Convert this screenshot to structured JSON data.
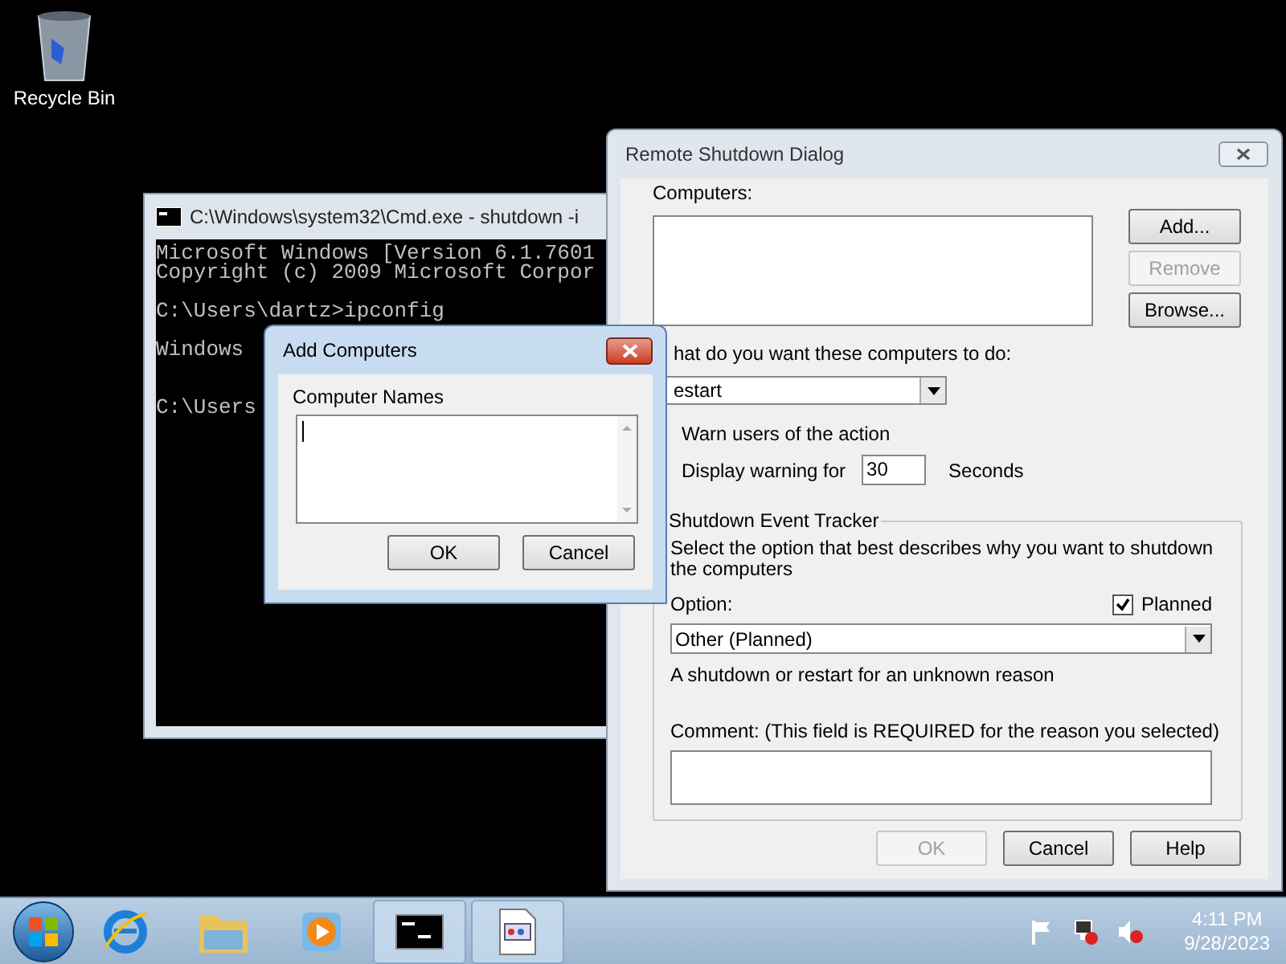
{
  "desktop_icons": [
    {
      "label": "Recycle Bin"
    }
  ],
  "cmd_window": {
    "title": "C:\\Windows\\system32\\Cmd.exe - shutdown  -i",
    "blocks": [
      [
        "Microsoft Windows [Version 6.1.7601",
        "Copyright (c) 2009 Microsoft Corpor"
      ],
      [
        "C:\\Users\\dartz>ipconfig"
      ],
      [
        "Windows"
      ],
      [
        "C:\\Users"
      ]
    ]
  },
  "add_computers": {
    "title": "Add Computers",
    "label": "Computer Names",
    "buttons": [
      "OK",
      "Cancel"
    ]
  },
  "remote_shutdown": {
    "title": "Remote Shutdown Dialog",
    "computers_label": "Computers:",
    "side_buttons": [
      {
        "label": "Add...",
        "disabled": false
      },
      {
        "label": "Remove",
        "disabled": true
      },
      {
        "label": "Browse...",
        "disabled": false
      }
    ],
    "action_label": "hat do you want these computers to do:",
    "action_value": "estart",
    "warn_label": "Warn users of the action",
    "display_label": "Display warning for",
    "display_value": "30",
    "seconds_label": "Seconds",
    "tracker": {
      "title": "Shutdown Event Tracker",
      "description": "Select the option that best describes why you want to shutdown the computers",
      "option_label": "Option:",
      "planned": {
        "label": "Planned",
        "checked": true
      },
      "option_value": "Other (Planned)",
      "reason": "A shutdown or restart for an unknown reason",
      "comment_label": "Comment: (This field is REQUIRED for the reason you selected)"
    },
    "buttons": [
      {
        "label": "OK",
        "disabled": true
      },
      {
        "label": "Cancel",
        "disabled": false
      },
      {
        "label": "Help",
        "disabled": false
      }
    ]
  },
  "taskbar": {
    "items": [
      {
        "kind": "start"
      },
      {
        "kind": "browser"
      },
      {
        "kind": "folder"
      },
      {
        "kind": "media"
      },
      {
        "kind": "console"
      },
      {
        "kind": "window"
      }
    ],
    "tray": [
      {
        "kind": "flag"
      },
      {
        "kind": "network"
      },
      {
        "kind": "volume"
      }
    ],
    "time": "4:11 PM",
    "date": "9/28/2023"
  }
}
